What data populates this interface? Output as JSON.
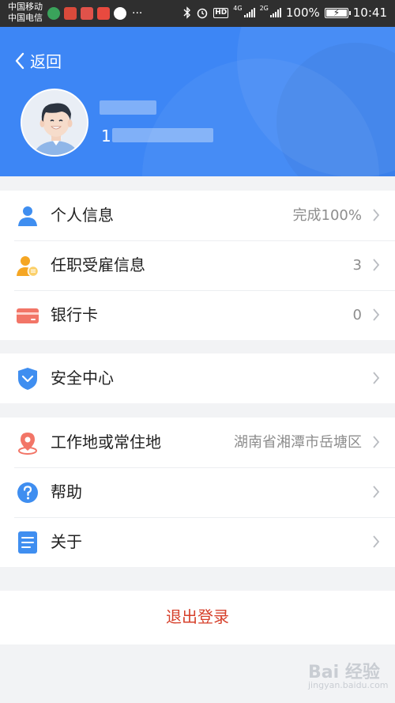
{
  "status_bar": {
    "carrier_1": "中国移动",
    "carrier_2": "中国电信",
    "more": "···",
    "hd": "HD",
    "net_1": "4G",
    "net_2": "2G",
    "battery": "100%",
    "time": "10:41"
  },
  "header": {
    "back_label": "返回",
    "phone_prefix": "1",
    "background_color": "#3d86f5"
  },
  "groups": [
    [
      {
        "label": "个人信息",
        "value": "完成100%",
        "icon": "person-icon"
      },
      {
        "label": "任职受雇信息",
        "value": "3",
        "icon": "employment-icon"
      },
      {
        "label": "银行卡",
        "value": "0",
        "icon": "bank-card-icon"
      }
    ],
    [
      {
        "label": "安全中心",
        "value": "",
        "icon": "shield-icon"
      }
    ],
    [
      {
        "label": "工作地或常住地",
        "value": "湖南省湘潭市岳塘区",
        "icon": "location-pin-icon"
      },
      {
        "label": "帮助",
        "value": "",
        "icon": "help-icon"
      },
      {
        "label": "关于",
        "value": "",
        "icon": "document-icon"
      }
    ]
  ],
  "logout_label": "退出登录",
  "watermark": {
    "text": "Bai 经验",
    "sub": "jingyan.baidu.com"
  },
  "colors": {
    "accent": "#3d86f5",
    "logout": "#d6402b"
  }
}
